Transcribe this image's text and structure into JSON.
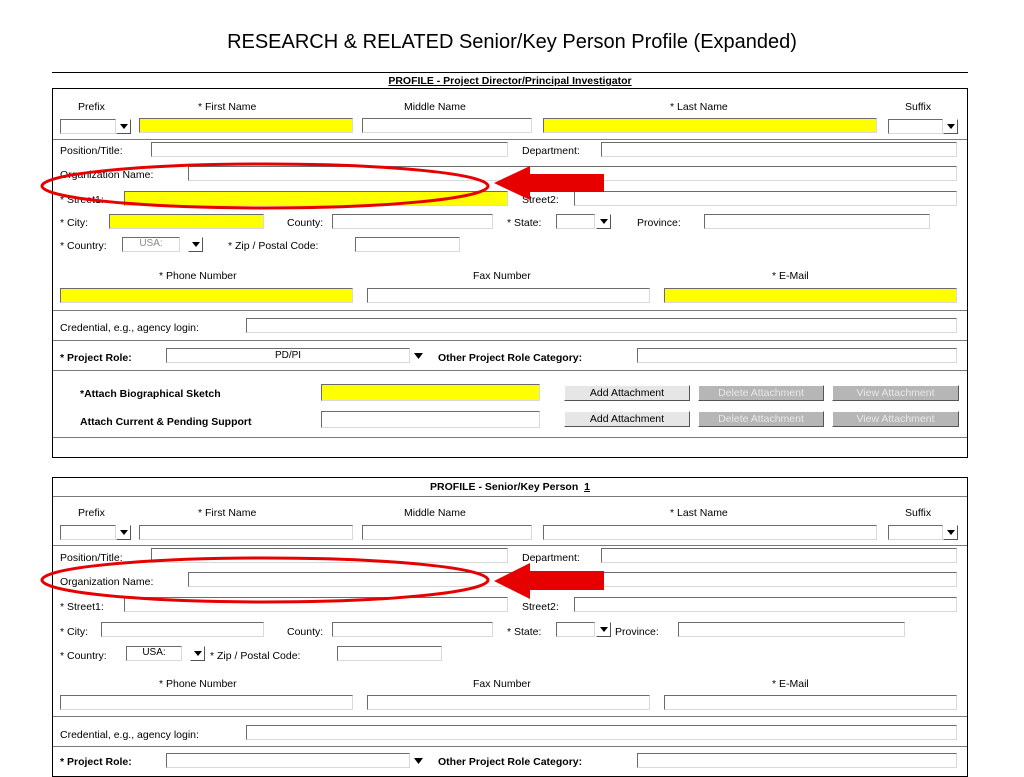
{
  "page": {
    "title": "RESEARCH & RELATED Senior/Key Person Profile (Expanded)"
  },
  "colors": {
    "required_field": "#ffff00",
    "annotation": "#e60000",
    "disabled_button": "#b6b6b6"
  },
  "pd_section": {
    "header": "PROFILE - Project Director/Principal Investigator",
    "prefix": "Prefix",
    "first_name": "* First Name",
    "middle_name": "Middle Name",
    "last_name": "* Last Name",
    "suffix": "Suffix",
    "position_title": "Position/Title:",
    "department": "Department:",
    "organization_name": "Organization Name:",
    "street1": "* Street1:",
    "street2": "Street2:",
    "city": "* City:",
    "county": "County:",
    "state": "* State:",
    "province": "Province:",
    "country": "* Country:",
    "country_value": "USA:",
    "zip": "* Zip / Postal Code:",
    "phone": "* Phone Number",
    "fax": "Fax Number",
    "email": "* E-Mail",
    "credential": "Credential, e.g., agency login:",
    "project_role": "* Project Role:",
    "project_role_value": "PD/PI",
    "other_role": "Other Project Role Category:",
    "attach_bio": "*Attach Biographical Sketch",
    "attach_support": "Attach Current & Pending Support",
    "add_attachment": "Add Attachment",
    "delete_attachment": "Delete Attachment",
    "view_attachment": "View Attachment"
  },
  "sk_section": {
    "header": "PROFILE - Senior/Key Person",
    "header_number": "1",
    "prefix": "Prefix",
    "first_name": "* First Name",
    "middle_name": "Middle Name",
    "last_name": "* Last Name",
    "suffix": "Suffix",
    "position_title": "Position/Title:",
    "department": "Department:",
    "organization_name": "Organization Name:",
    "street1": "* Street1:",
    "street2": "Street2:",
    "city": "* City:",
    "county": "County:",
    "state": "* State:",
    "province": "Province:",
    "country": "* Country:",
    "country_value": "USA:",
    "zip": "* Zip / Postal Code:",
    "phone": "* Phone Number",
    "fax": "Fax Number",
    "email": "* E-Mail",
    "credential": "Credential, e.g., agency login:",
    "project_role": "* Project Role:",
    "other_role": "Other Project Role Category:"
  }
}
